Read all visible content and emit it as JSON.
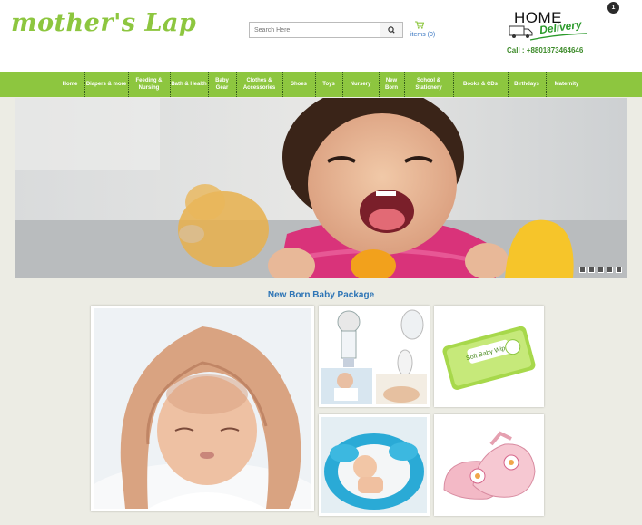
{
  "header": {
    "logo_text": "mother's Lap",
    "search": {
      "placeholder": "Search Here",
      "button_icon": "search-icon"
    },
    "cart": {
      "label": "items (0)",
      "icon": "shopping-cart-icon"
    },
    "delivery": {
      "home": "HOME",
      "delivery": "Delivery"
    },
    "phone": "Call : +8801873464646",
    "corner_icon": "account-icon"
  },
  "nav": {
    "items": [
      {
        "label": "Home"
      },
      {
        "label": "Diapers & more"
      },
      {
        "label": "Feeding & Nursing"
      },
      {
        "label": "Bath & Health"
      },
      {
        "label": "Baby Gear"
      },
      {
        "label": "Clothes & Accessories"
      },
      {
        "label": "Shoes"
      },
      {
        "label": "Toys"
      },
      {
        "label": "Nursery"
      },
      {
        "label": "New Born"
      },
      {
        "label": "School & Stationery"
      },
      {
        "label": "Books & CDs"
      },
      {
        "label": "Birthdays"
      },
      {
        "label": "Maternity"
      }
    ]
  },
  "slider": {
    "slide_count": 5,
    "active_slide": 1
  },
  "package": {
    "title": "New Born Baby Package",
    "items": [
      "newborn-photo",
      "breast-pump",
      "soft-baby-wipes",
      "baby-bath-flower",
      "pink-sandals"
    ],
    "wipes_text": "Soft Baby Wipes"
  },
  "colors": {
    "brand_green": "#8dc63f",
    "title_blue": "#2e75b6",
    "page_bg": "#ecece4"
  }
}
